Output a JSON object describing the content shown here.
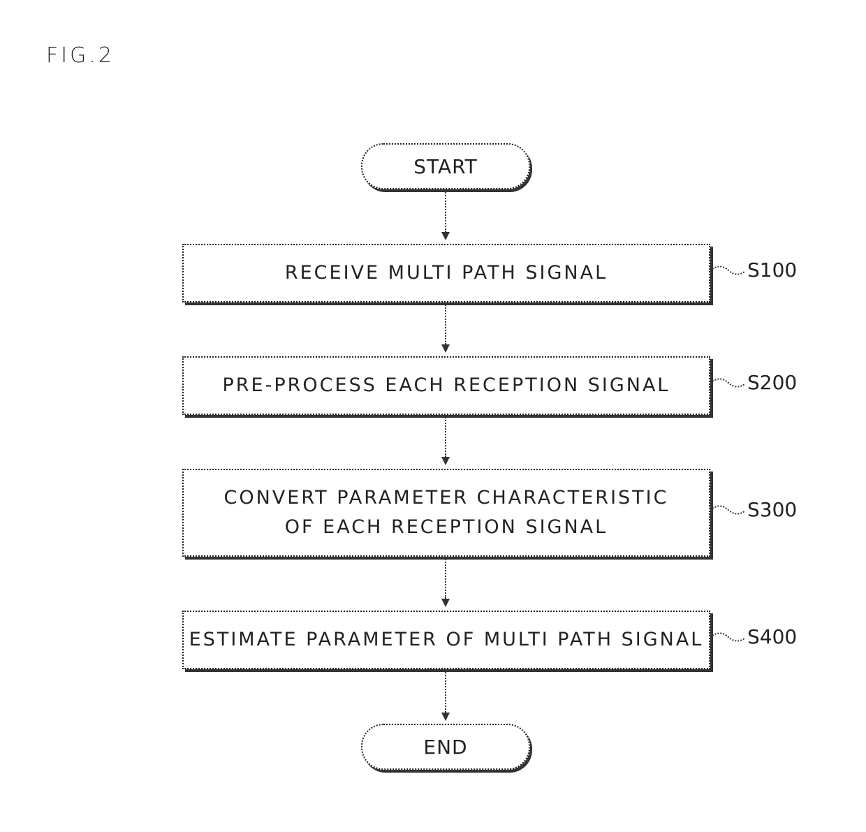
{
  "figure": {
    "label": "FIG.2"
  },
  "flowchart": {
    "start": {
      "label": "START"
    },
    "steps": [
      {
        "id": "S100",
        "text": "RECEIVE MULTI PATH SIGNAL"
      },
      {
        "id": "S200",
        "text": "PRE-PROCESS EACH RECEPTION SIGNAL"
      },
      {
        "id": "S300",
        "text": "CONVERT PARAMETER CHARACTERISTIC\nOF EACH RECEPTION SIGNAL"
      },
      {
        "id": "S400",
        "text": "ESTIMATE PARAMETER OF MULTI PATH SIGNAL"
      }
    ],
    "end": {
      "label": "END"
    }
  }
}
